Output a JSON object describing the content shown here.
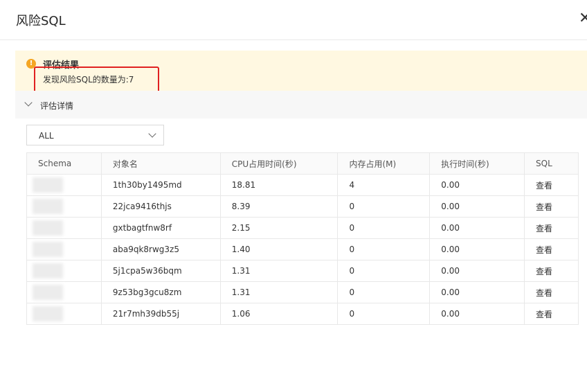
{
  "dialog": {
    "title": "风险SQL",
    "close_glyph": "✕"
  },
  "alert": {
    "icon": "warning-icon",
    "title": "评估结果",
    "message": "发现风险SQL的数量为:7"
  },
  "details": {
    "label": "评估详情"
  },
  "filter": {
    "value": "ALL"
  },
  "table": {
    "headers": [
      "Schema",
      "对象名",
      "CPU占用时间(秒)",
      "内存占用(M)",
      "执行时间(秒)",
      "SQL"
    ],
    "rows": [
      {
        "object": "1th30by1495md",
        "cpu": "18.81",
        "mem": "4",
        "exec": "0.00",
        "sql": "查看"
      },
      {
        "object": "22jca9416thjs",
        "cpu": "8.39",
        "mem": "0",
        "exec": "0.00",
        "sql": "查看"
      },
      {
        "object": "gxtbagtfnw8rf",
        "cpu": "2.15",
        "mem": "0",
        "exec": "0.00",
        "sql": "查看"
      },
      {
        "object": "aba9qk8rwg3z5",
        "cpu": "1.40",
        "mem": "0",
        "exec": "0.00",
        "sql": "查看"
      },
      {
        "object": "5j1cpa5w36bqm",
        "cpu": "1.31",
        "mem": "0",
        "exec": "0.00",
        "sql": "查看"
      },
      {
        "object": "9z53bg3gcu8zm",
        "cpu": "1.31",
        "mem": "0",
        "exec": "0.00",
        "sql": "查看"
      },
      {
        "object": "21r7mh39db55j",
        "cpu": "1.06",
        "mem": "0",
        "exec": "0.00",
        "sql": "查看"
      }
    ]
  }
}
